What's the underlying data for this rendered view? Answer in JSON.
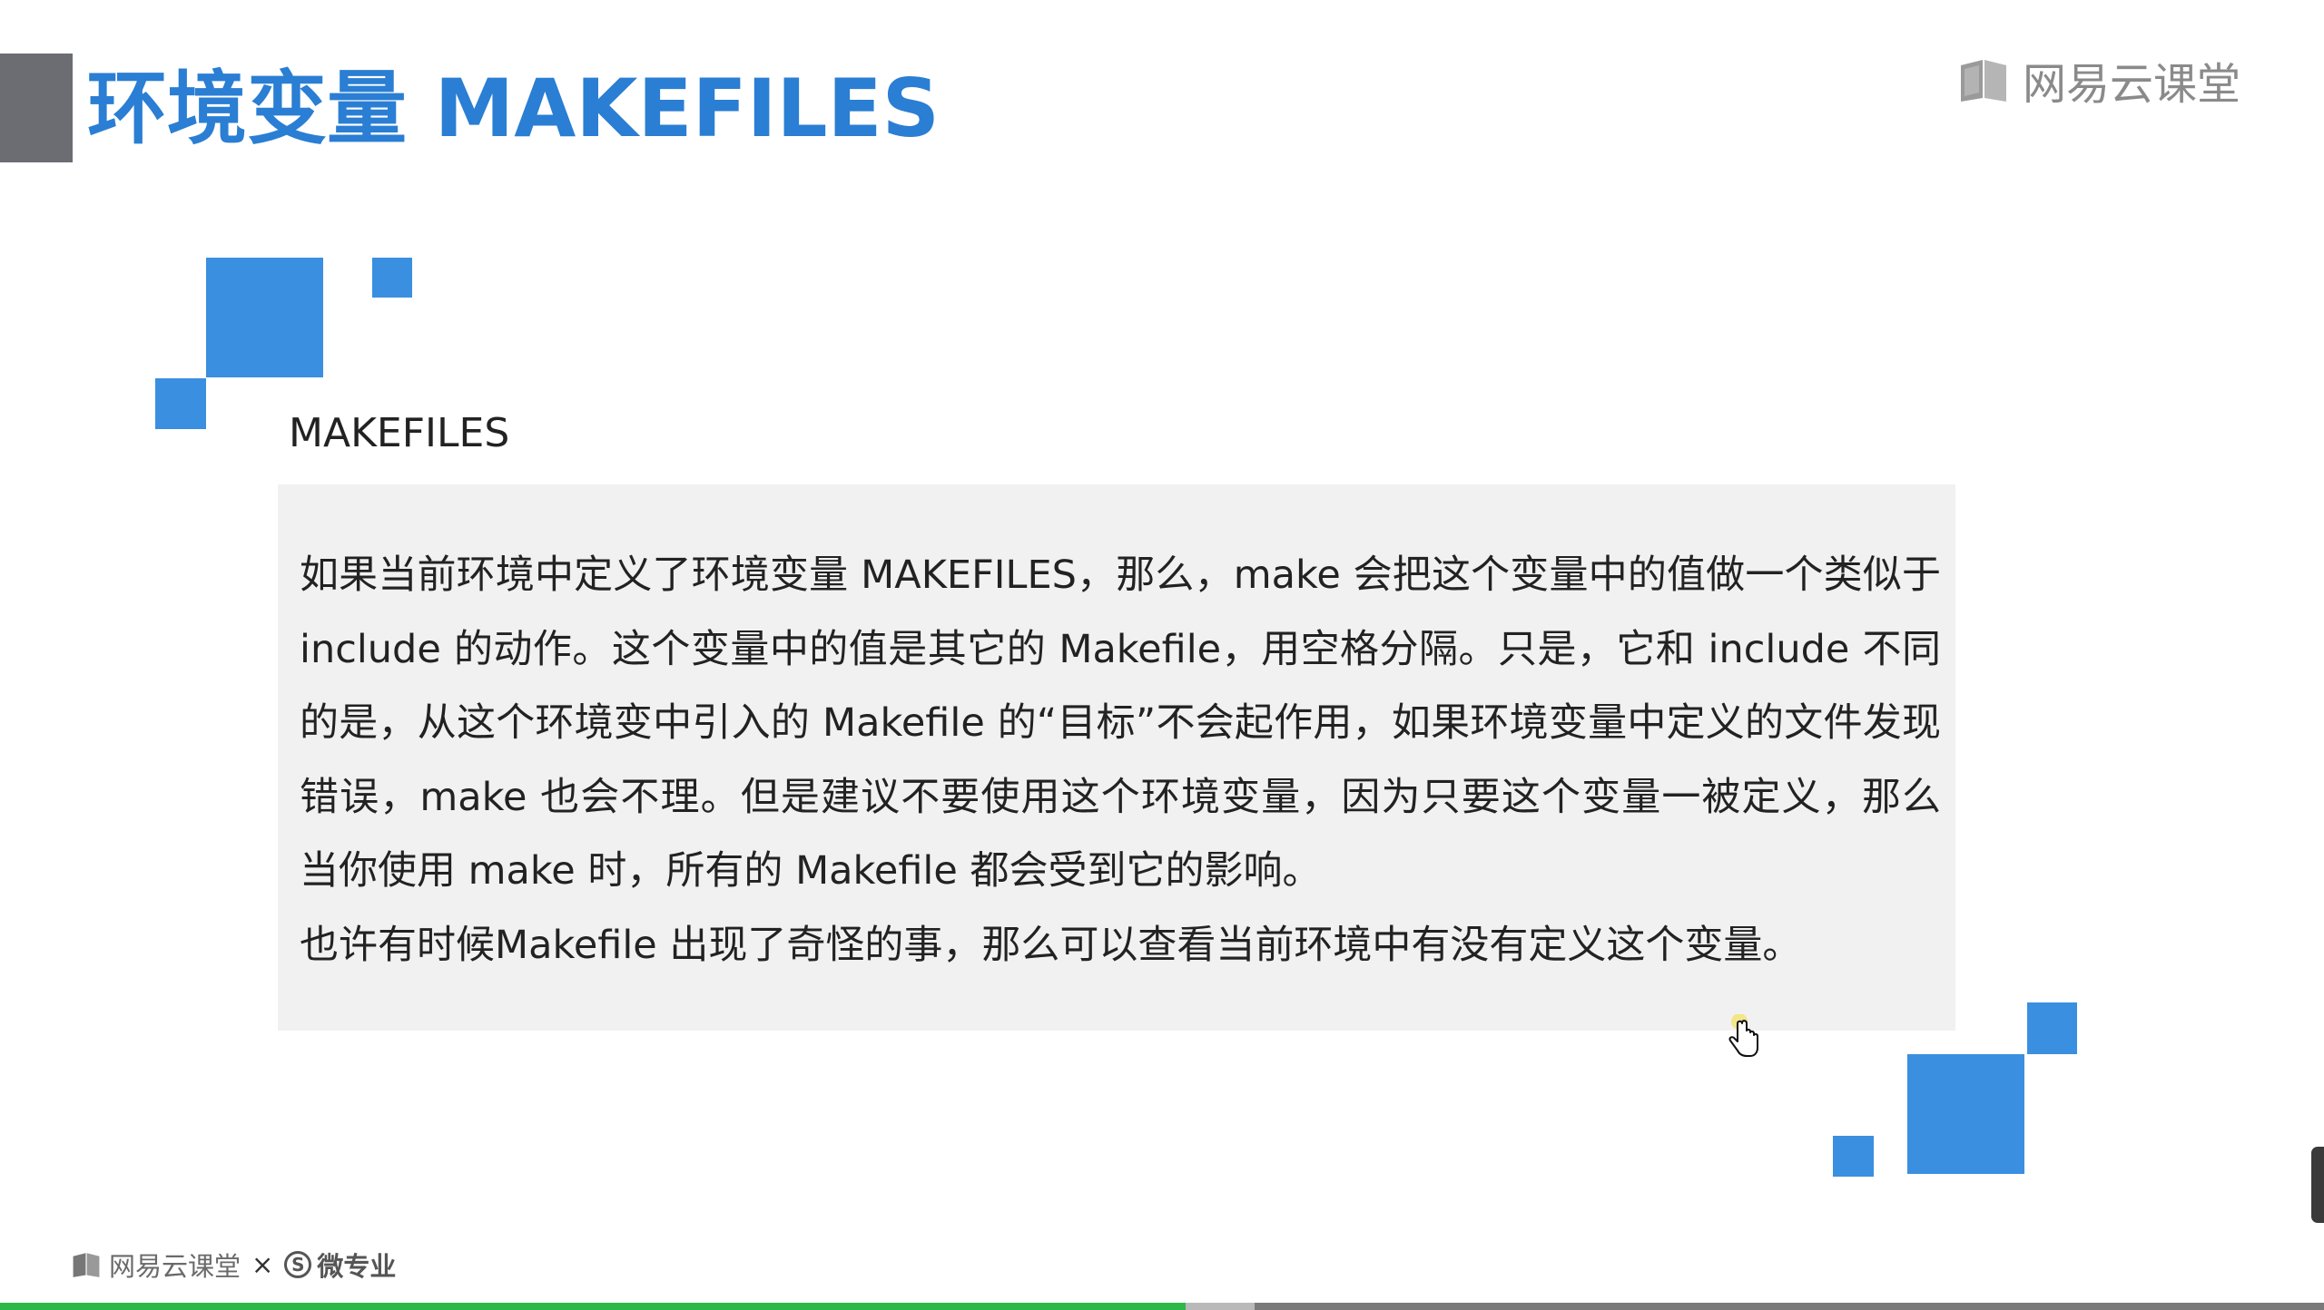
{
  "slide": {
    "title": "环境变量 MAKEFILES",
    "brand_top": "网易云课堂",
    "subtitle": "MAKEFILES",
    "paragraph1": "如果当前环境中定义了环境变量 MAKEFILES，那么，make 会把这个变量中的值做一个类似于 include 的动作。这个变量中的值是其它的 Makefile，用空格分隔。只是，它和 include 不同的是，从这个环境变中引入的 Makefile 的“目标”不会起作用，如果环境变量中定义的文件发现错误，make 也会不理。但是建议不要使用这个环境变量，因为只要这个变量一被定义，那么当你使用 make 时，所有的 Makefile 都会受到它的影响。",
    "paragraph2": "也许有时候Makefile 出现了奇怪的事，那么可以查看当前环境中有没有定义这个变量。"
  },
  "footer": {
    "brand": "网易云课堂",
    "separator": "×",
    "micro_symbol": "S",
    "micro_label": "微专业"
  },
  "player": {
    "progress_fraction": 0.51,
    "buffered_fraction": 0.54
  },
  "colors": {
    "title": "#2a7ed3",
    "accent_blocks": "#3a8fe0",
    "title_bar": "#6c6d72",
    "content_bg": "#f1f1f2",
    "progress": "#2eb84a"
  },
  "icons": {
    "brand_book": "book-icon",
    "cursor": "hand-pointer-icon"
  }
}
